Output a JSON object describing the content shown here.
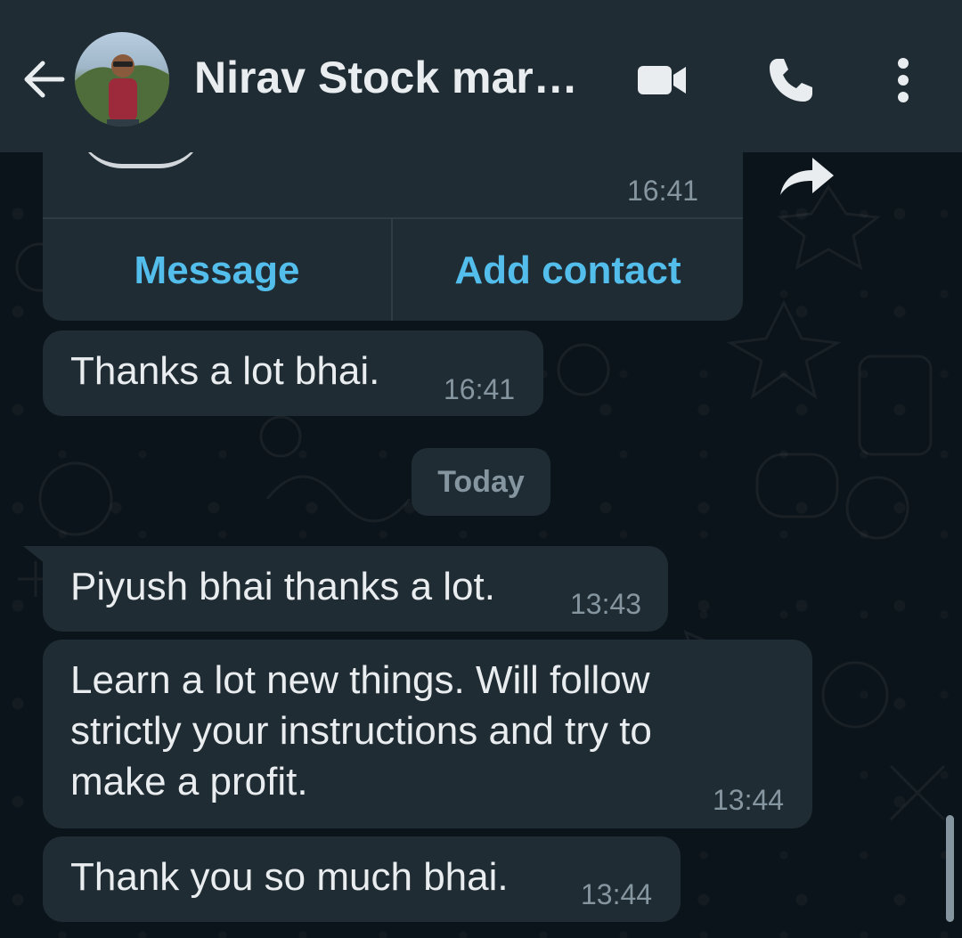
{
  "header": {
    "contact_name": "Nirav Stock mark...",
    "back_icon": "arrow-left-icon",
    "video_icon": "video-camera-icon",
    "call_icon": "phone-icon",
    "menu_icon": "more-vertical-icon",
    "background_color": "#1f2c34"
  },
  "contact_card": {
    "time": "16:41",
    "message_label": "Message",
    "add_contact_label": "Add contact",
    "forward_icon": "forward-icon"
  },
  "messages_before": [
    {
      "text": "Thanks a lot bhai.",
      "time": "16:41"
    }
  ],
  "date_separator": "Today",
  "messages_today": [
    {
      "text": "Piyush bhai thanks a lot.",
      "time": "13:43"
    },
    {
      "lines": [
        "Learn a lot new things. Will follow",
        "strictly your instructions and try to",
        "make a profit."
      ],
      "time": "13:44"
    },
    {
      "text": "Thank you so much bhai.",
      "time": "13:44"
    }
  ],
  "colors": {
    "chat_background": "#0b141a",
    "bubble": "#202c33",
    "link_accent": "#53bdeb",
    "primary_text": "#e9edef",
    "secondary_text": "#8696a0"
  }
}
